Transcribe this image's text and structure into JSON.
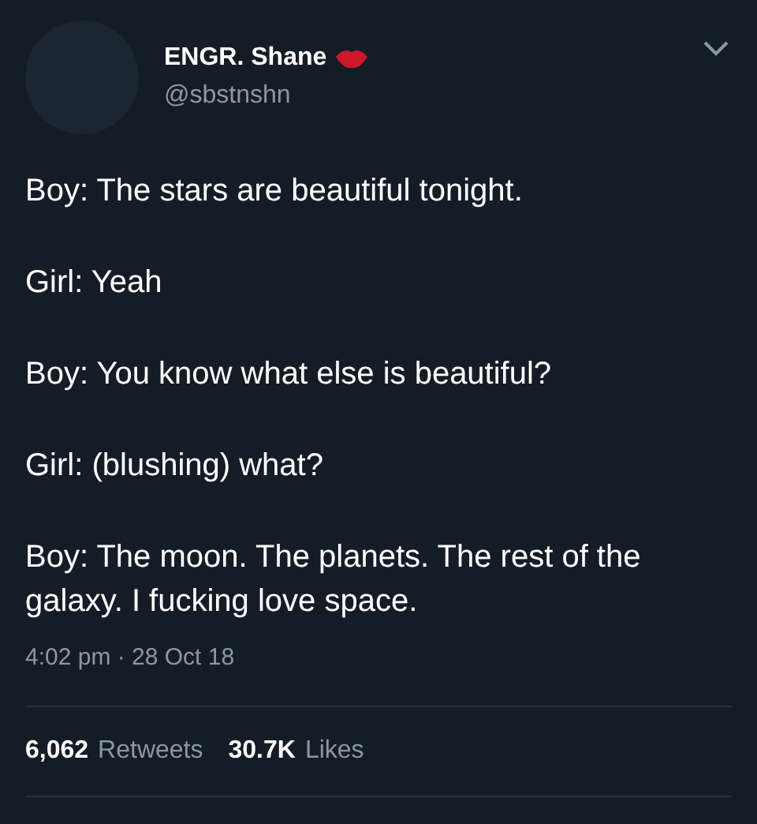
{
  "author": {
    "name": "ENGR. Shane",
    "handle": "@sbstnshn"
  },
  "body": [
    "Boy: The stars are beautiful tonight.",
    "Girl: Yeah",
    "Boy: You know what else is beautiful?",
    "Girl: (blushing) what?",
    "Boy: The moon. The planets. The rest of the galaxy. I fucking love space."
  ],
  "timestamp": "4:02 pm · 28 Oct 18",
  "stats": [
    {
      "count": "6,062",
      "label": "Retweets"
    },
    {
      "count": "30.7K",
      "label": "Likes"
    }
  ]
}
